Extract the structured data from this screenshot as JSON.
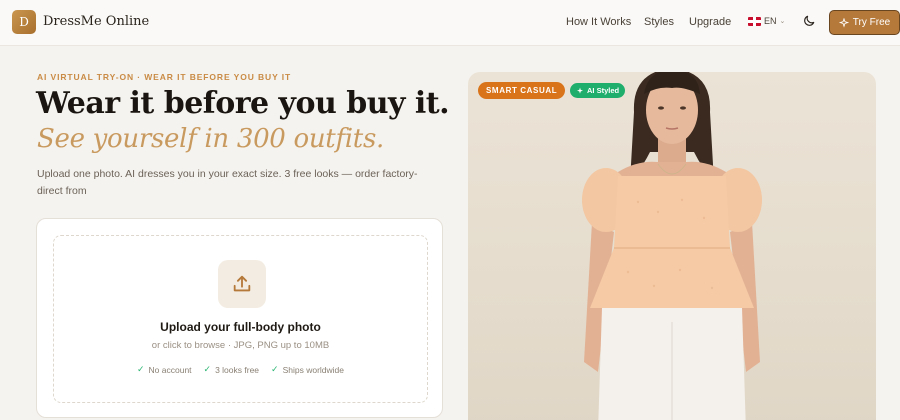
{
  "nav": {
    "logo_letter": "D",
    "brand": "DressMe Online",
    "links": [
      "How It Works",
      "Styles",
      "Upgrade"
    ],
    "lang": "EN",
    "cta": "Try Free",
    "icons": {
      "logo": "logo-mark",
      "lang": "uk-flag-icon",
      "theme": "moon-icon",
      "cta": "sparkle-icon"
    }
  },
  "hero": {
    "eyebrow": "AI VIRTUAL TRY-ON · WEAR IT BEFORE YOU BUY IT",
    "headline": "Wear it before you buy it.",
    "subhead": "See yourself in 300 outfits.",
    "description": "Upload one photo. AI dresses you in your exact size. 3 free looks — order factory-direct from"
  },
  "upload": {
    "title": "Upload your full-body photo",
    "subtitle": "or click to browse · JPG, PNG up to 10MB",
    "perks": [
      "No account",
      "3 looks free",
      "Ships worldwide"
    ],
    "icon": "upload-icon"
  },
  "preview": {
    "style_badge": "SMART CASUAL",
    "ai_badge": "AI Styled",
    "colors": {
      "style_badge": "#d9741a",
      "ai_badge": "#1fae6c",
      "accent": "#b5793a"
    }
  }
}
